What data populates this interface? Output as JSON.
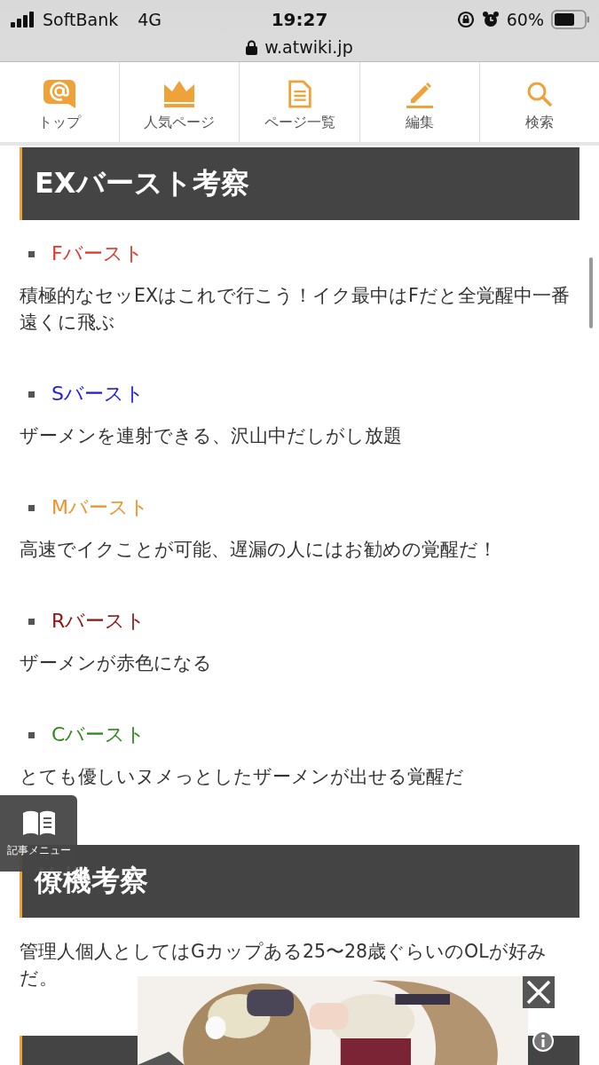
{
  "status_bar": {
    "carrier": "SoftBank",
    "network": "4G",
    "time": "19:27",
    "battery": "60%"
  },
  "address_bar": {
    "url": "w.atwiki.jp"
  },
  "nav": [
    {
      "label": "トップ",
      "kind": "at"
    },
    {
      "label": "人気ページ",
      "kind": "crown"
    },
    {
      "label": "ページ一覧",
      "kind": "page"
    },
    {
      "label": "編集",
      "kind": "pencil"
    },
    {
      "label": "検索",
      "kind": "search"
    }
  ],
  "sections": [
    {
      "heading": "EXバースト考察",
      "entries": [
        {
          "label": "Fバースト",
          "color": "#e2372b",
          "text": "積極的なセッEXはこれで行こう！イク最中はFだと全覚醒中一番遠くに飛ぶ"
        },
        {
          "label": "Sバースト",
          "color": "#1c1ce6",
          "text": "ザーメンを連射できる、沢山中だしがし放題"
        },
        {
          "label": "Mバースト",
          "color": "#f0922c",
          "text": "高速でイクことが可能、遅漏の人にはお勧めの覚醒だ！"
        },
        {
          "label": "Rバースト",
          "color": "#8e1414",
          "text": "ザーメンが赤色になる"
        },
        {
          "label": "Cバースト",
          "color": "#2f8a1e",
          "text": "とても優しいヌメっとしたザーメンが出せる覚醒だ"
        }
      ]
    },
    {
      "heading": "僚機考察",
      "paragraphs": [
        "管理人個人としてはGカップある25〜28歳ぐらいのOLが好みだ。"
      ]
    }
  ],
  "article_menu": {
    "label": "記事メニュー"
  }
}
